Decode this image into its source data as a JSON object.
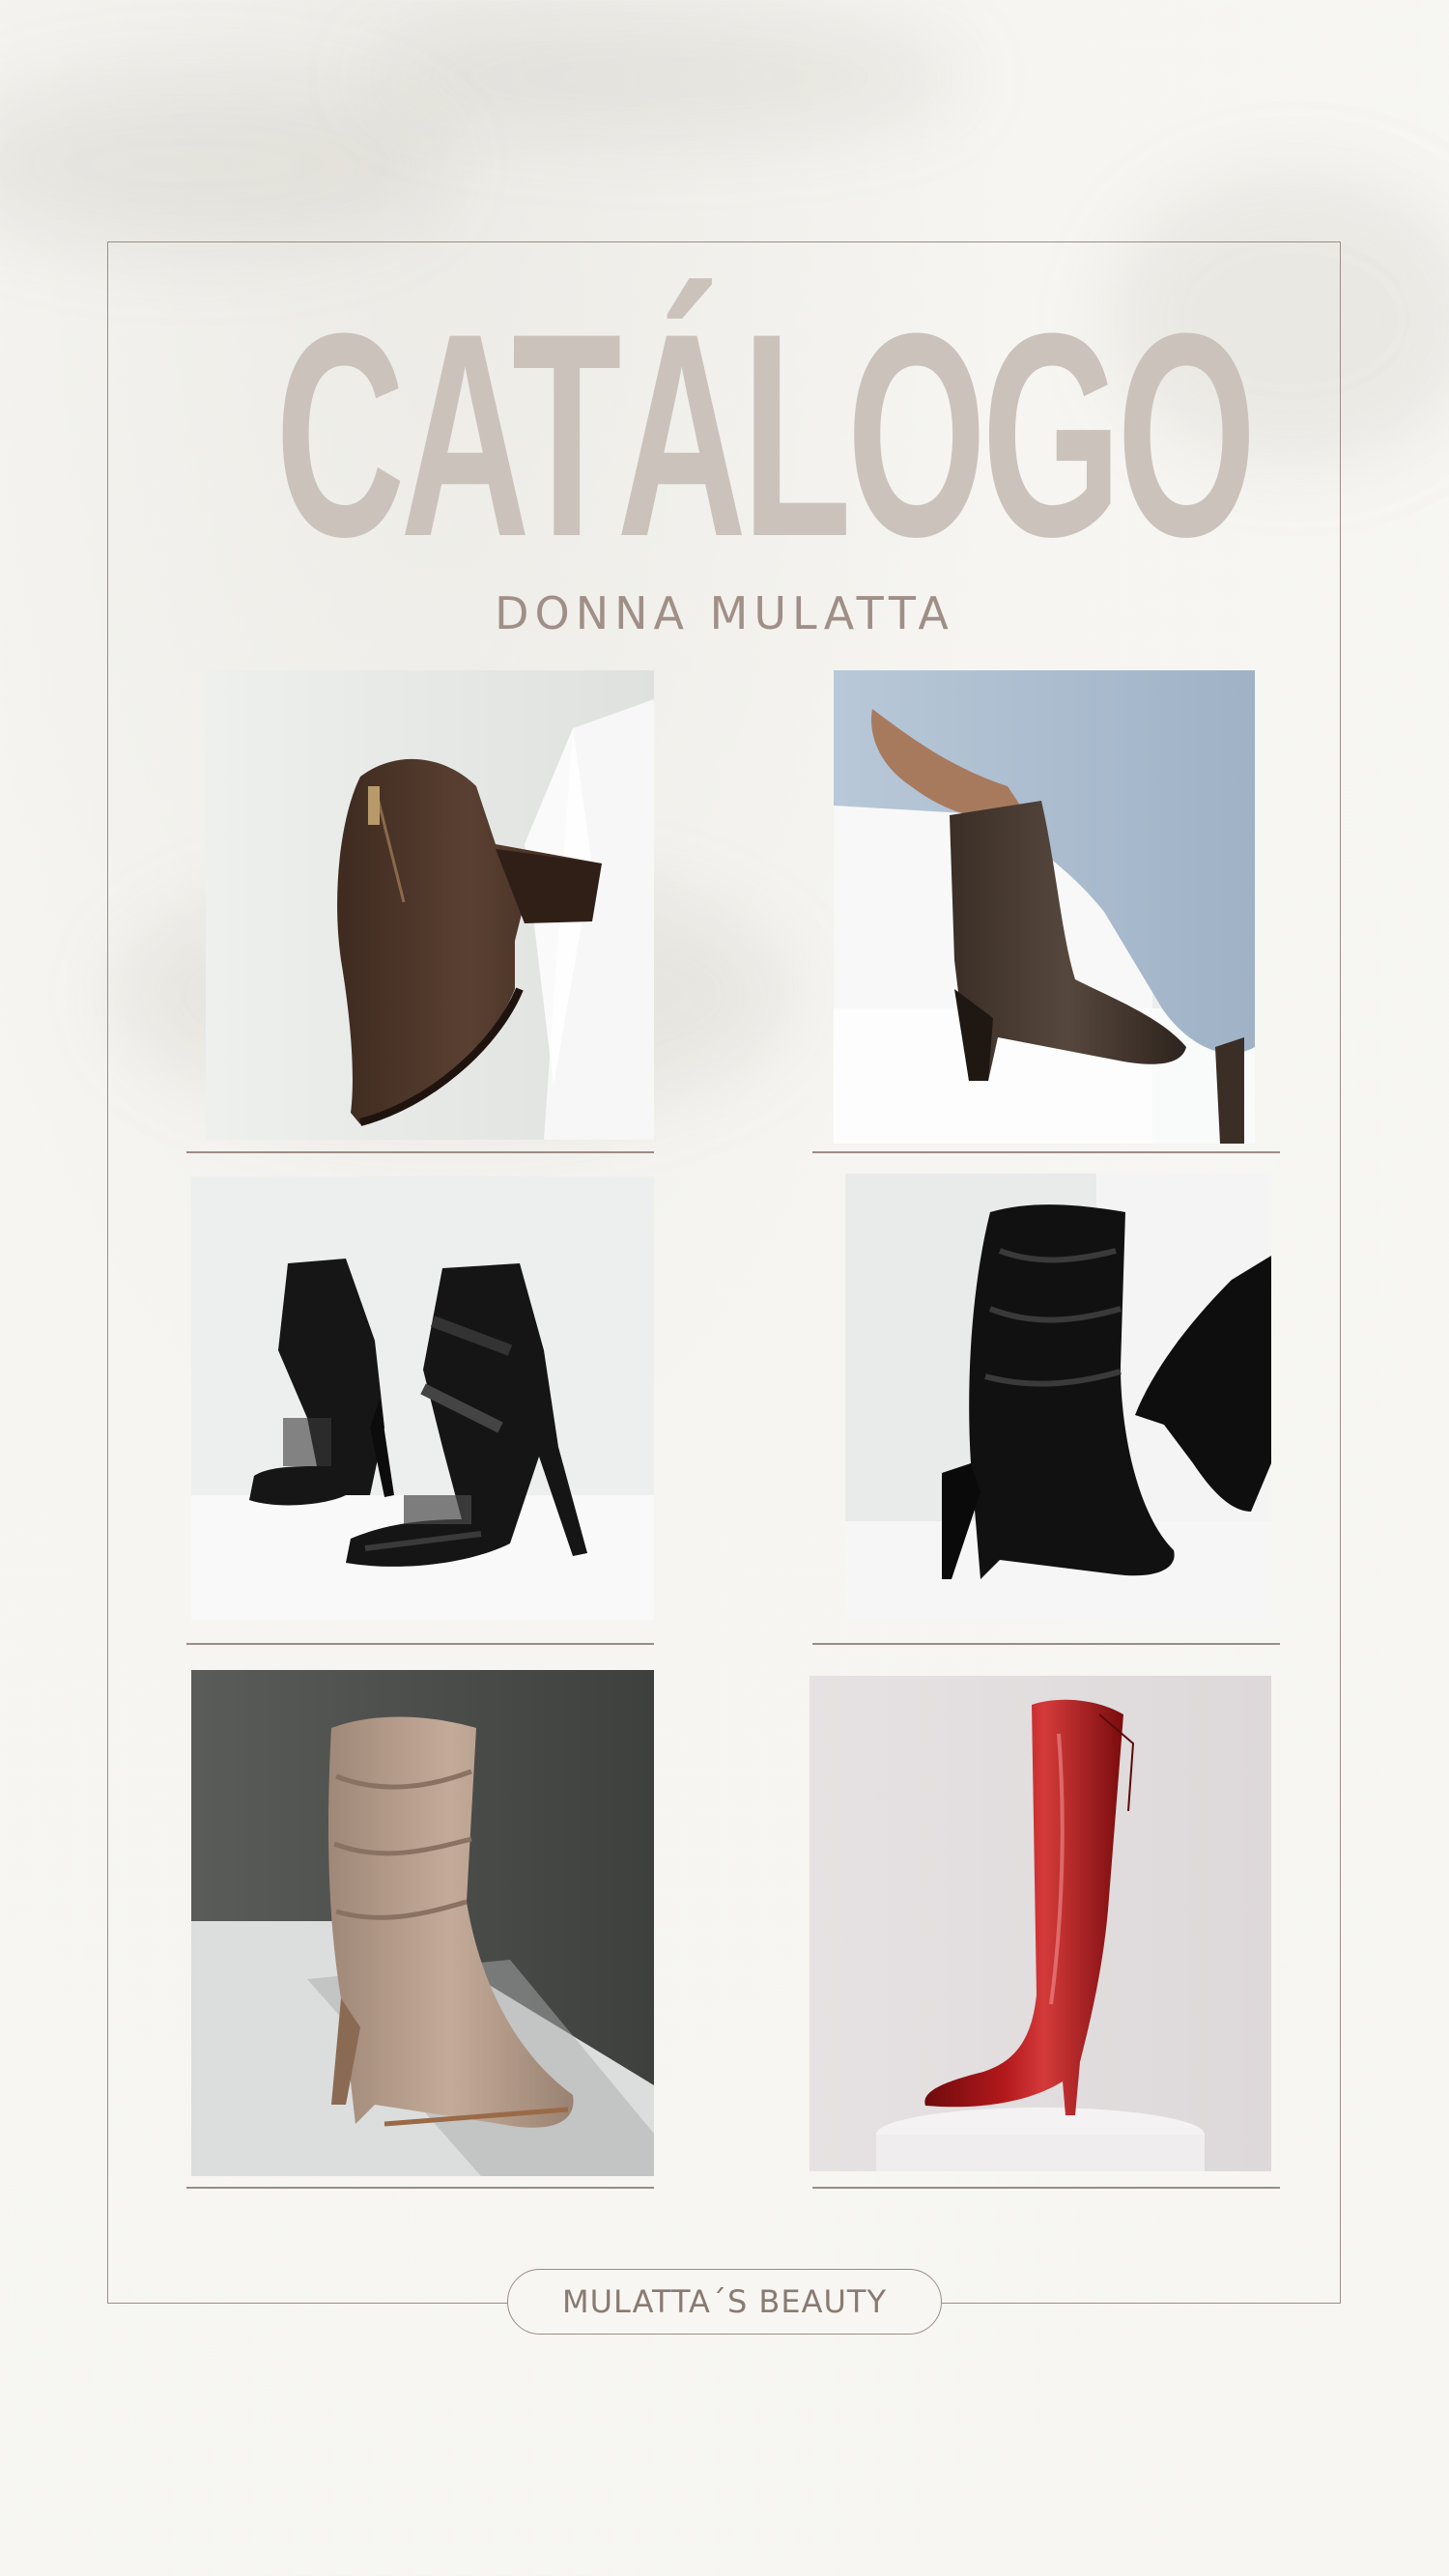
{
  "title": "CATÁLOGO",
  "subtitle": "DONNA MULATTA",
  "footer_label": "MULATTA´S BEAUTY",
  "colors": {
    "background": "#f7f6f2",
    "title": "#cbc3bb",
    "subtitle": "#a08f87",
    "frame_line": "#9c8c85"
  },
  "products": [
    {
      "name": "brown-ankle-boot",
      "description_icon": "brown-leather-ankle-boot-with-zipper"
    },
    {
      "name": "brown-mid-calf-boot",
      "description_icon": "brown-boot-worn-with-jeans"
    },
    {
      "name": "black-strappy-heels",
      "description_icon": "black-strappy-heeled-sandals"
    },
    {
      "name": "black-slouch-boot",
      "description_icon": "black-patent-slouch-boot"
    },
    {
      "name": "beige-suede-boot",
      "description_icon": "beige-suede-slouch-boot"
    },
    {
      "name": "red-knee-boot",
      "description_icon": "red-patent-over-knee-boot"
    }
  ]
}
